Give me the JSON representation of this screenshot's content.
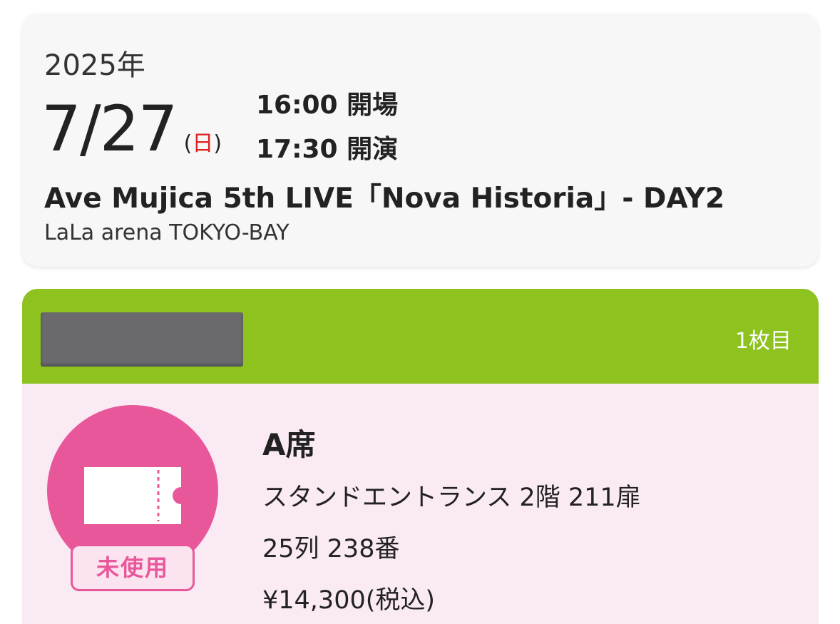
{
  "event": {
    "year": "2025年",
    "date": "7/27",
    "weekday_open": "(",
    "weekday": "日",
    "weekday_close": ")",
    "open_time": "16:00 開場",
    "start_time": "17:30 開演",
    "title": "Ave Mujica 5th LIVE「Nova Historia」- DAY2",
    "venue": "LaLa arena TOKYO-BAY"
  },
  "ticket": {
    "count_label": "1枚目",
    "status": "未使用",
    "seat_class": "A席",
    "entrance": "スタンドエントランス  2階 211扉",
    "row_seat": "25列 238番",
    "price": "¥14,300(税込)",
    "icon": "ticket-icon"
  },
  "colors": {
    "header_green": "#8dc21f",
    "status_pink": "#e9579b",
    "body_pink": "#faeaf3",
    "weekday_red": "#e02020"
  }
}
